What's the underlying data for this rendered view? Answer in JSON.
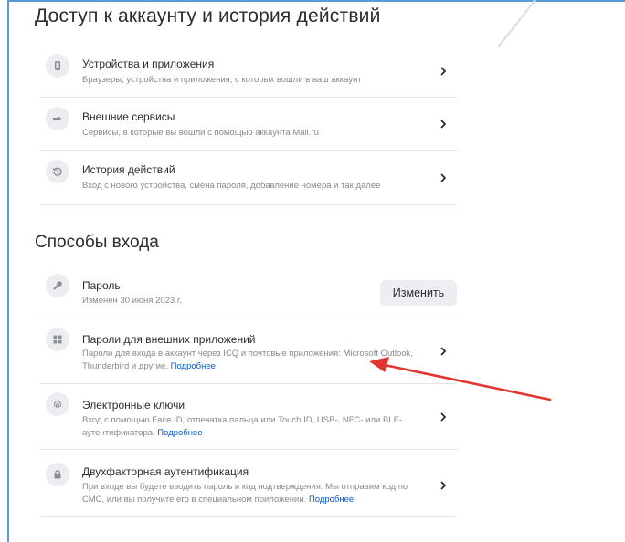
{
  "sections": {
    "access_title": "Доступ к аккаунту и история действий",
    "login_title": "Способы входа"
  },
  "access_items": [
    {
      "title": "Устройства и приложения",
      "subtitle": "Браузеры, устройства и приложения, с которых вошли в ваш аккаунт",
      "icon": "device-icon"
    },
    {
      "title": "Внешние сервисы",
      "subtitle": "Сервисы, в которые вы вошли с помощью аккаунта Mail.ru",
      "icon": "external-arrow-icon"
    },
    {
      "title": "История действий",
      "subtitle": "Вход с нового устройства, смена пароля, добавление номера и так далее",
      "icon": "history-icon"
    }
  ],
  "login_items": [
    {
      "title": "Пароль",
      "subtitle": "Изменен 30 июня 2023 г.",
      "button": "Изменить",
      "icon": "key-icon"
    },
    {
      "title": "Пароли для внешних приложений",
      "subtitle": "Пароли для входа в аккаунт через ICQ и почтовые приложения: Microsoft Outlook, Thunderbird и другие.",
      "link": "Подробнее",
      "icon": "grid-icon"
    },
    {
      "title": "Электронные ключи",
      "subtitle": "Вход с помощью Face ID, отпечатка пальца или Touch ID, USB-, NFC- или BLE-аутентификатора.",
      "link": "Подробнее",
      "icon": "fingerprint-icon"
    },
    {
      "title": "Двухфакторная аутентификация",
      "subtitle": "При входе вы будете вводить пароль и код подтверждения. Мы отправим код по СМС, или вы получите его в специальном приложении.",
      "link": "Подробнее",
      "icon": "lock-icon"
    }
  ],
  "colors": {
    "accent_link": "#005bd1",
    "annotation_arrow": "#e0362f",
    "frame": "#5b9bd5"
  }
}
